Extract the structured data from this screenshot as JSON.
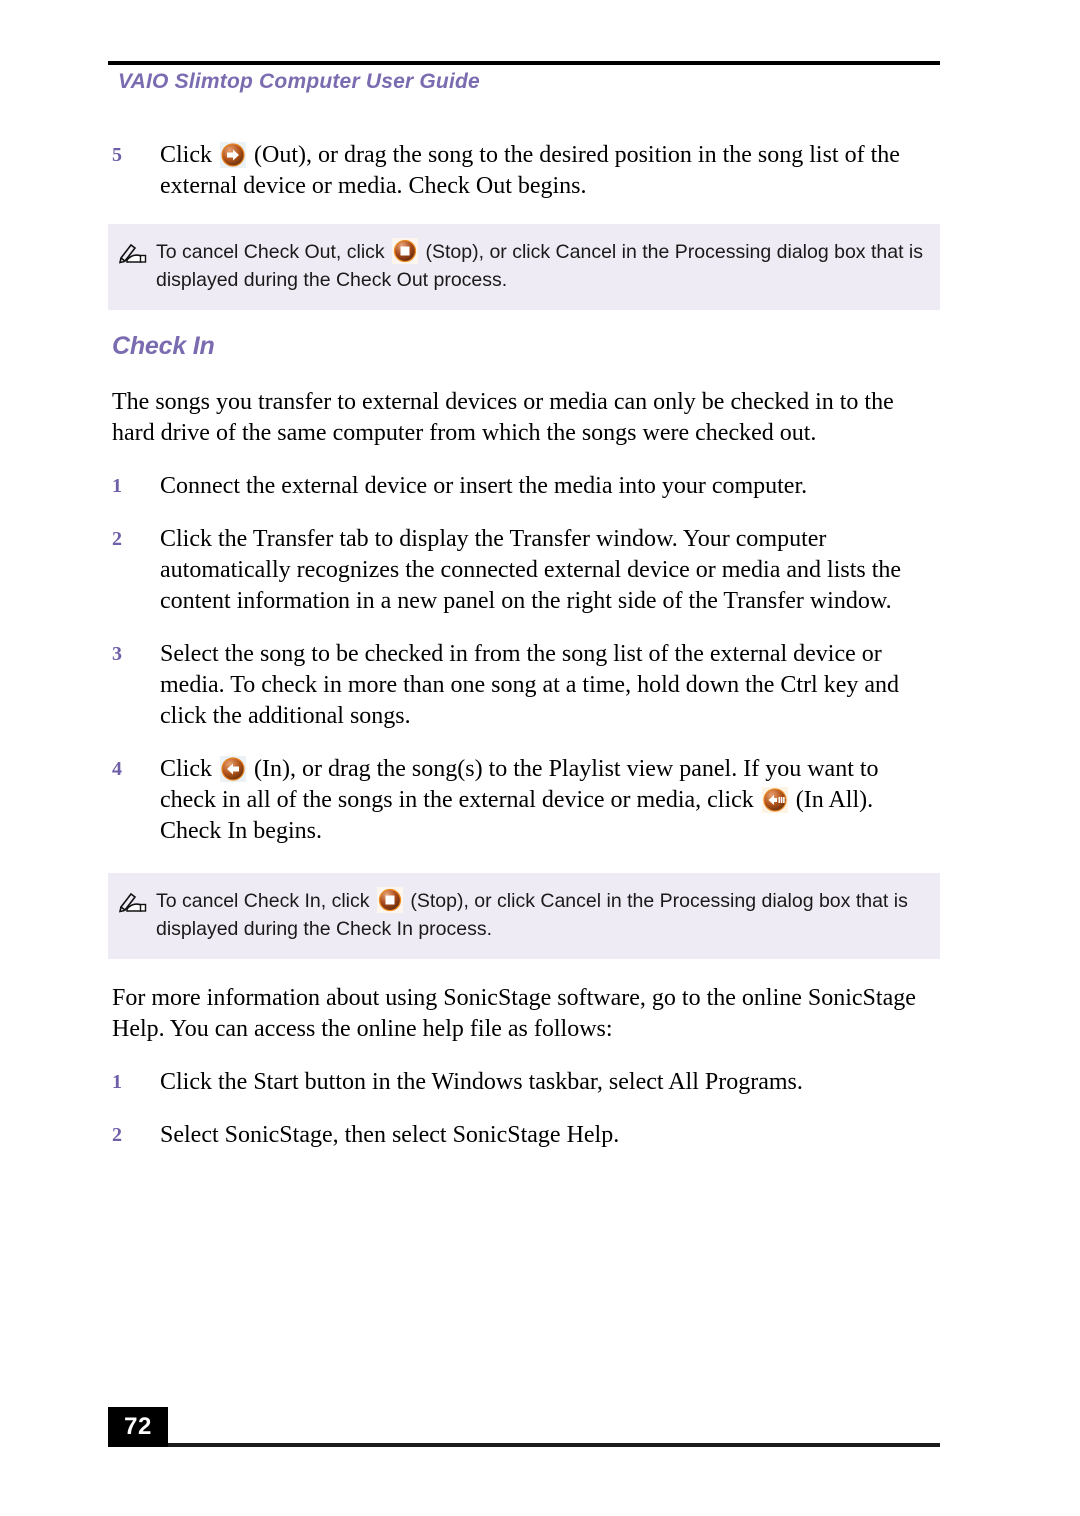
{
  "header": {
    "title": "VAIO Slimtop Computer User Guide"
  },
  "content": {
    "step5": {
      "num": "5",
      "text_before_icon": "Click",
      "icon": "check-out-icon",
      "text_after_icon": "(Out), or drag the song to the desired position in the song list of the external device or media. Check Out begins."
    },
    "note1": {
      "icon": "note-pencil-icon",
      "text_before_icon": "To cancel Check Out, click",
      "inline_icon": "stop-icon",
      "text_after_icon": "(Stop), or click Cancel in the Processing dialog box that is displayed during the Check Out process."
    },
    "section_heading": "Check In",
    "intro_paragraph": "The songs you transfer to external devices or media can only be checked in to the hard drive of the same computer from which the songs were checked out.",
    "step1": {
      "num": "1",
      "text": "Connect the external device or insert the media into your computer."
    },
    "step2": {
      "num": "2",
      "text": "Click the Transfer tab to display the Transfer window. Your computer automatically recognizes the connected external device or media and lists the content information in a new panel on the right side of the Transfer window."
    },
    "step3": {
      "num": "3",
      "text": "Select the song to be checked in from the song list of the external device or media. To check in more than one song at a time, hold down the Ctrl key and click the additional songs."
    },
    "step4": {
      "num": "4",
      "text_before_icon": "Click",
      "icon1": "check-in-icon",
      "text_mid": "(In), or drag the song(s) to the Playlist view panel. If you want to check in all of the songs in the external device or media, click",
      "icon2": "check-in-all-icon",
      "text_after_icon": "(In All). Check In begins."
    },
    "note2": {
      "icon": "note-pencil-icon",
      "text_before_icon": "To cancel Check In, click",
      "inline_icon": "stop-icon",
      "text_after_icon": "(Stop), or click Cancel in the Processing dialog box that is displayed during the Check In process."
    },
    "help_paragraph": "For more information about using SonicStage software, go to the online SonicStage Help. You can access the online help file as follows:",
    "help_step1": {
      "num": "1",
      "text": "Click the Start button in the Windows taskbar, select All Programs."
    },
    "help_step2": {
      "num": "2",
      "text": "Select SonicStage, then select SonicStage Help."
    }
  },
  "footer": {
    "page_number": "72"
  },
  "colors": {
    "accent_purple": "#7b6bb0",
    "step_number_purple": "#6f5ea8",
    "note_background": "#eeebf4",
    "icon_orange": "#c85a14",
    "icon_brown": "#6b3310"
  }
}
